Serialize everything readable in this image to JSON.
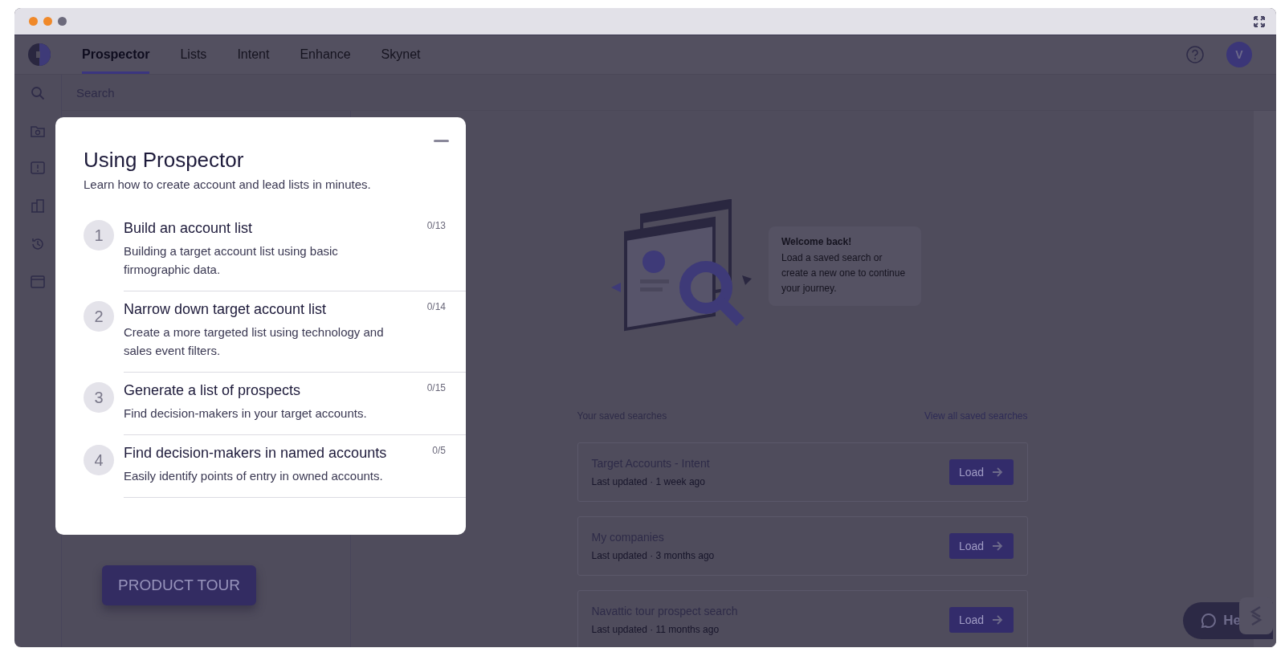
{
  "nav": {
    "tabs": [
      {
        "label": "Prospector",
        "selected": true
      },
      {
        "label": "Lists",
        "selected": false
      },
      {
        "label": "Intent",
        "selected": false
      },
      {
        "label": "Enhance",
        "selected": false
      },
      {
        "label": "Skynet",
        "selected": false
      }
    ],
    "avatar": "V"
  },
  "search_header": {
    "title": "Search"
  },
  "guide": {
    "title": "Using Prospector",
    "subtitle": "Learn how to create account and lead lists in minutes.",
    "steps": [
      {
        "number": "1",
        "title": "Build an account list",
        "description": "Building a target account list using basic firmographic data.",
        "progress": "0/13"
      },
      {
        "number": "2",
        "title": "Narrow down target account list",
        "description": "Create a more targeted list using technology and sales event filters.",
        "progress": "0/14"
      },
      {
        "number": "3",
        "title": "Generate a list of prospects",
        "description": "Find decision-makers in your target accounts.",
        "progress": "0/15"
      },
      {
        "number": "4",
        "title": "Find decision-makers in named accounts",
        "description": "Easily identify points of entry in owned accounts.",
        "progress": "0/5"
      }
    ]
  },
  "welcome": {
    "title": "Welcome back!",
    "text": "Load a saved search or create a new one to continue your journey."
  },
  "saved_searches": {
    "title": "Your saved searches",
    "view_all": "View all saved searches",
    "items": [
      {
        "name": "Target Accounts - Intent",
        "updated": "Last updated · 1 week ago",
        "button": "Load"
      },
      {
        "name": "My companies",
        "updated": "Last updated · 3 months ago",
        "button": "Load"
      },
      {
        "name": "Navattic tour prospect search",
        "updated": "Last updated · 11 months ago",
        "button": "Load"
      }
    ]
  },
  "product_tour": {
    "label": "PRODUCT TOUR"
  },
  "help": {
    "label": "He"
  }
}
